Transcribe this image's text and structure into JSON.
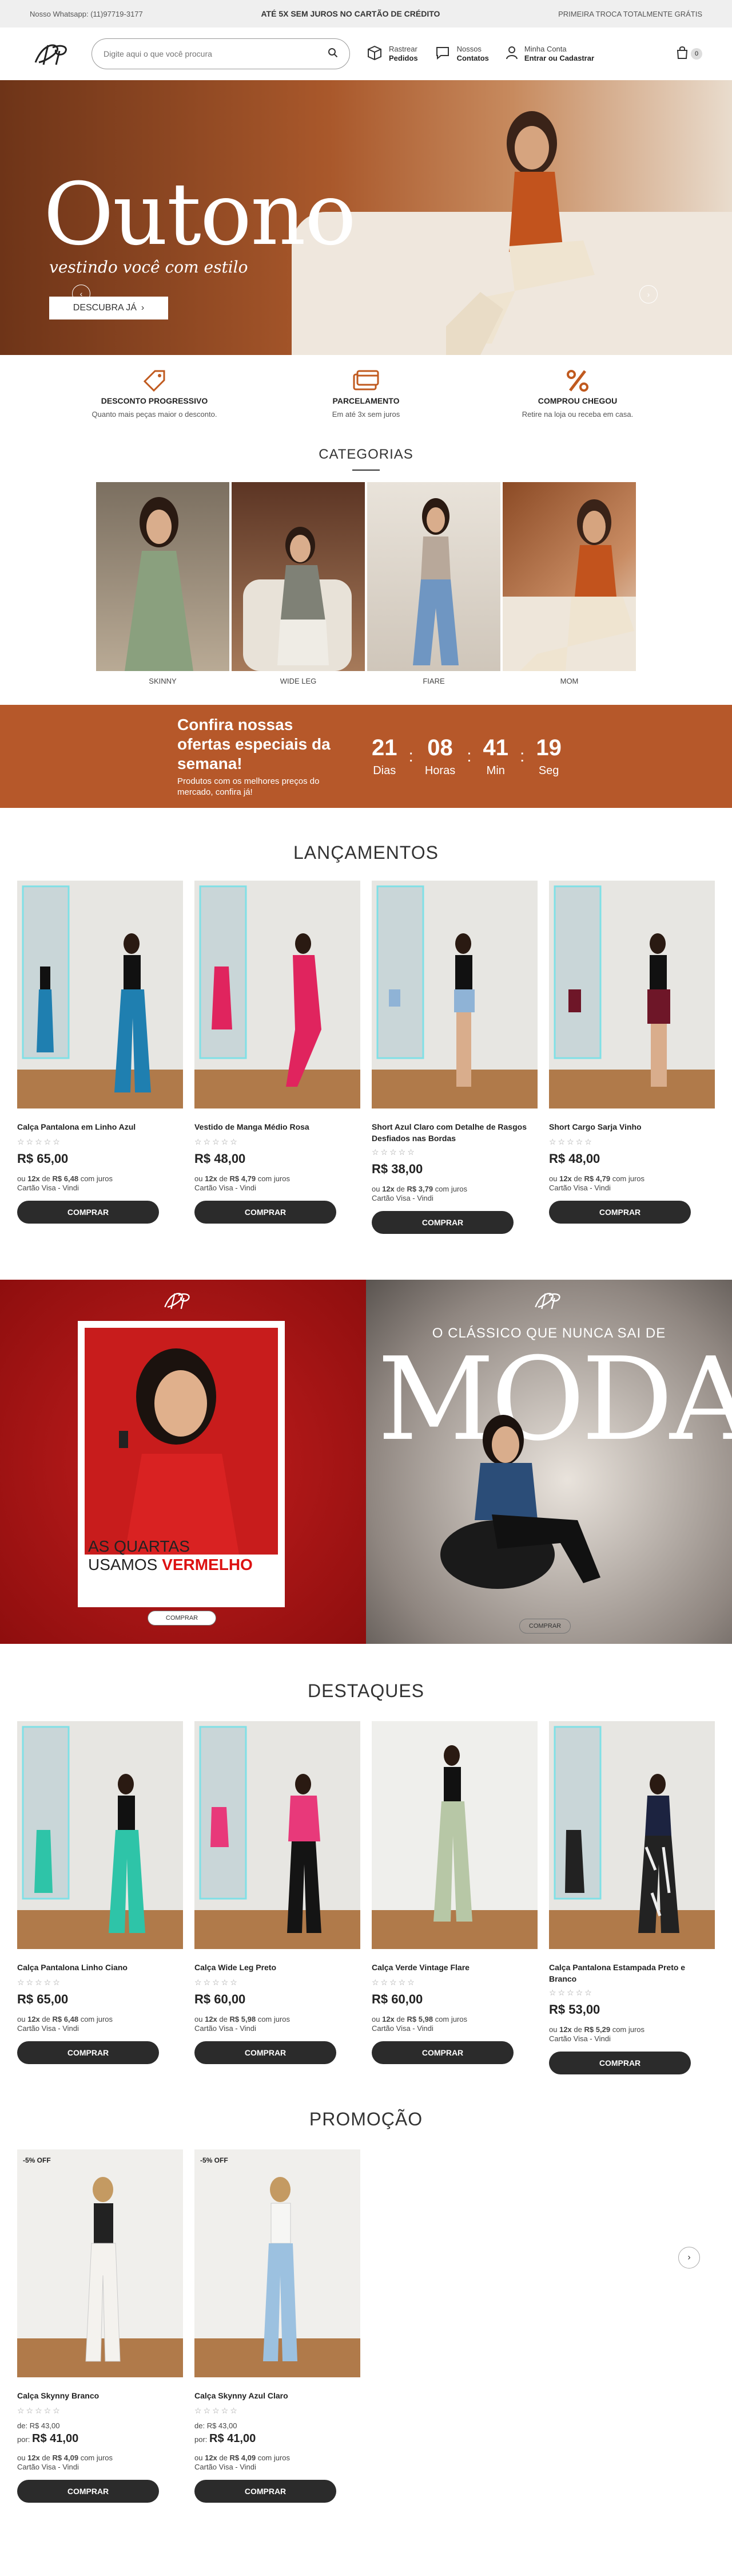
{
  "topbar": {
    "whatsapp": "Nosso Whatsapp: (11)97719-3177",
    "promo": "ATÉ 5X SEM JUROS NO CARTÃO DE CRÉDITO",
    "exchange": "PRIMEIRA TROCA TOTALMENTE GRÁTIS"
  },
  "header": {
    "search_placeholder": "Digite aqui o que você procura",
    "track_line1": "Rastrear",
    "track_line2": "Pedidos",
    "contact_line1": "Nossos",
    "contact_line2": "Contatos",
    "account_line1": "Minha Conta",
    "account_line2": "Entrar ou Cadastrar",
    "cart_count": "0"
  },
  "hero": {
    "title": "Outono",
    "subtitle": "vestindo você com estilo",
    "cta": "DESCUBRA JÁ"
  },
  "features": [
    {
      "title": "DESCONTO PROGRESSIVO",
      "desc": "Quanto mais peças maior o desconto.",
      "icon": "discount-tag-icon"
    },
    {
      "title": "PARCELAMENTO",
      "desc": "Em até 3x sem juros",
      "icon": "credit-card-icon"
    },
    {
      "title": "COMPROU CHEGOU",
      "desc": "Retire na loja ou receba em casa.",
      "icon": "percent-icon"
    }
  ],
  "categories": {
    "title": "CATEGORIAS",
    "items": [
      "SKINNY",
      "WIDE LEG",
      "FIARE",
      "MOM"
    ]
  },
  "offer": {
    "title": "Confira nossas ofertas especiais da semana!",
    "desc": "Produtos com os melhores preços do mercado, confira já!",
    "days": "21",
    "days_label": "Dias",
    "hours": "08",
    "hours_label": "Horas",
    "minutes": "41",
    "minutes_label": "Min",
    "seconds": "19",
    "seconds_label": "Seg"
  },
  "launches": {
    "title": "LANÇAMENTOS",
    "products": [
      {
        "name": "Calça Pantalona em Linho Azul",
        "price": "R$ 65,00",
        "inst_prefix": "ou",
        "inst_count": "12x",
        "inst_de": "de",
        "inst_value": "R$ 6,48",
        "inst_suffix": "com juros",
        "inst_card": "Cartão Visa - Vindi",
        "button": "COMPRAR"
      },
      {
        "name": "Vestido de Manga Médio Rosa",
        "price": "R$ 48,00",
        "inst_prefix": "ou",
        "inst_count": "12x",
        "inst_de": "de",
        "inst_value": "R$ 4,79",
        "inst_suffix": "com juros",
        "inst_card": "Cartão Visa - Vindi",
        "button": "COMPRAR"
      },
      {
        "name": "Short Azul Claro com Detalhe de Rasgos Desfiados nas Bordas",
        "price": "R$ 38,00",
        "inst_prefix": "ou",
        "inst_count": "12x",
        "inst_de": "de",
        "inst_value": "R$ 3,79",
        "inst_suffix": "com juros",
        "inst_card": "Cartão Visa - Vindi",
        "button": "COMPRAR"
      },
      {
        "name": "Short Cargo Sarja Vinho",
        "price": "R$ 48,00",
        "inst_prefix": "ou",
        "inst_count": "12x",
        "inst_de": "de",
        "inst_value": "R$ 4,79",
        "inst_suffix": "com juros",
        "inst_card": "Cartão Visa - Vindi",
        "button": "COMPRAR"
      }
    ]
  },
  "banners": {
    "red_line1": "AS QUARTAS",
    "red_line2_a": "USAMOS",
    "red_line2_b": "VERMELHO",
    "red_button": "COMPRAR",
    "dark_sub": "O CLÁSSICO QUE NUNCA SAI DE",
    "dark_title": "MODA",
    "dark_button": "COMPRAR"
  },
  "highlights": {
    "title": "DESTAQUES",
    "products": [
      {
        "name": "Calça Pantalona Linho Ciano",
        "price": "R$ 65,00",
        "inst_prefix": "ou",
        "inst_count": "12x",
        "inst_de": "de",
        "inst_value": "R$ 6,48",
        "inst_suffix": "com juros",
        "inst_card": "Cartão Visa - Vindi",
        "button": "COMPRAR"
      },
      {
        "name": "Calça Wide Leg Preto",
        "price": "R$ 60,00",
        "inst_prefix": "ou",
        "inst_count": "12x",
        "inst_de": "de",
        "inst_value": "R$ 5,98",
        "inst_suffix": "com juros",
        "inst_card": "Cartão Visa - Vindi",
        "button": "COMPRAR"
      },
      {
        "name": "Calça Verde Vintage Flare",
        "price": "R$ 60,00",
        "inst_prefix": "ou",
        "inst_count": "12x",
        "inst_de": "de",
        "inst_value": "R$ 5,98",
        "inst_suffix": "com juros",
        "inst_card": "Cartão Visa - Vindi",
        "button": "COMPRAR"
      },
      {
        "name": "Calça Pantalona Estampada Preto e Branco",
        "price": "R$ 53,00",
        "inst_prefix": "ou",
        "inst_count": "12x",
        "inst_de": "de",
        "inst_value": "R$ 5,29",
        "inst_suffix": "com juros",
        "inst_card": "Cartão Visa - Vindi",
        "button": "COMPRAR"
      }
    ]
  },
  "promo": {
    "title": "PROMOÇÃO",
    "products": [
      {
        "tag": "-5% OFF",
        "name": "Calça Skynny Branco",
        "old_label": "de:",
        "old_price": "R$ 43,00",
        "new_label": "por:",
        "price": "R$ 41,00",
        "inst_prefix": "ou",
        "inst_count": "12x",
        "inst_de": "de",
        "inst_value": "R$ 4,09",
        "inst_suffix": "com juros",
        "inst_card": "Cartão Visa - Vindi",
        "button": "COMPRAR"
      },
      {
        "tag": "-5% OFF",
        "name": "Calça Skynny Azul Claro",
        "old_label": "de:",
        "old_price": "R$ 43,00",
        "new_label": "por:",
        "price": "R$ 41,00",
        "inst_prefix": "ou",
        "inst_count": "12x",
        "inst_de": "de",
        "inst_value": "R$ 4,09",
        "inst_suffix": "com juros",
        "inst_card": "Cartão Visa - Vindi",
        "button": "COMPRAR"
      }
    ]
  },
  "colors": {
    "accent": "#b6582a",
    "button": "#2b2b2b",
    "red_banner": "#c41e1e"
  }
}
